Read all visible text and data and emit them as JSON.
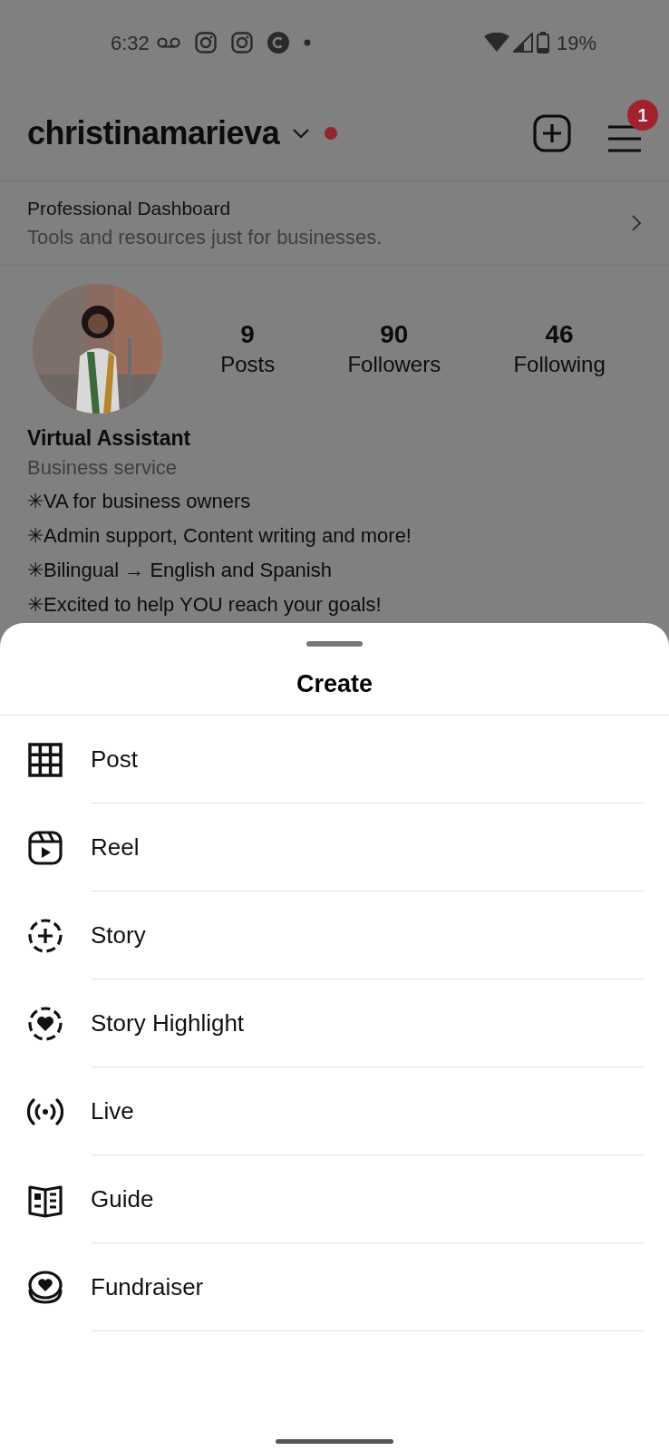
{
  "status_bar": {
    "time": "6:32",
    "battery": "19%"
  },
  "header": {
    "username": "christinamarieva",
    "notification_count": "1"
  },
  "dashboard": {
    "title": "Professional Dashboard",
    "subtitle": "Tools and resources just for businesses."
  },
  "stats": [
    {
      "value": "9",
      "label": "Posts"
    },
    {
      "value": "90",
      "label": "Followers"
    },
    {
      "value": "46",
      "label": "Following"
    }
  ],
  "bio": {
    "name": "Virtual Assistant",
    "category": "Business service",
    "lines": [
      "✳VA for business owners",
      "✳Admin support, Content writing and more!",
      "✳Bilingual → English and Spanish",
      "✳Excited to help YOU reach your goals!"
    ]
  },
  "sheet": {
    "title": "Create",
    "items": [
      {
        "label": "Post",
        "kind": "post"
      },
      {
        "label": "Reel",
        "kind": "reel"
      },
      {
        "label": "Story",
        "kind": "story"
      },
      {
        "label": "Story Highlight",
        "kind": "highlight"
      },
      {
        "label": "Live",
        "kind": "live"
      },
      {
        "label": "Guide",
        "kind": "guide"
      },
      {
        "label": "Fundraiser",
        "kind": "fundraiser"
      }
    ]
  }
}
